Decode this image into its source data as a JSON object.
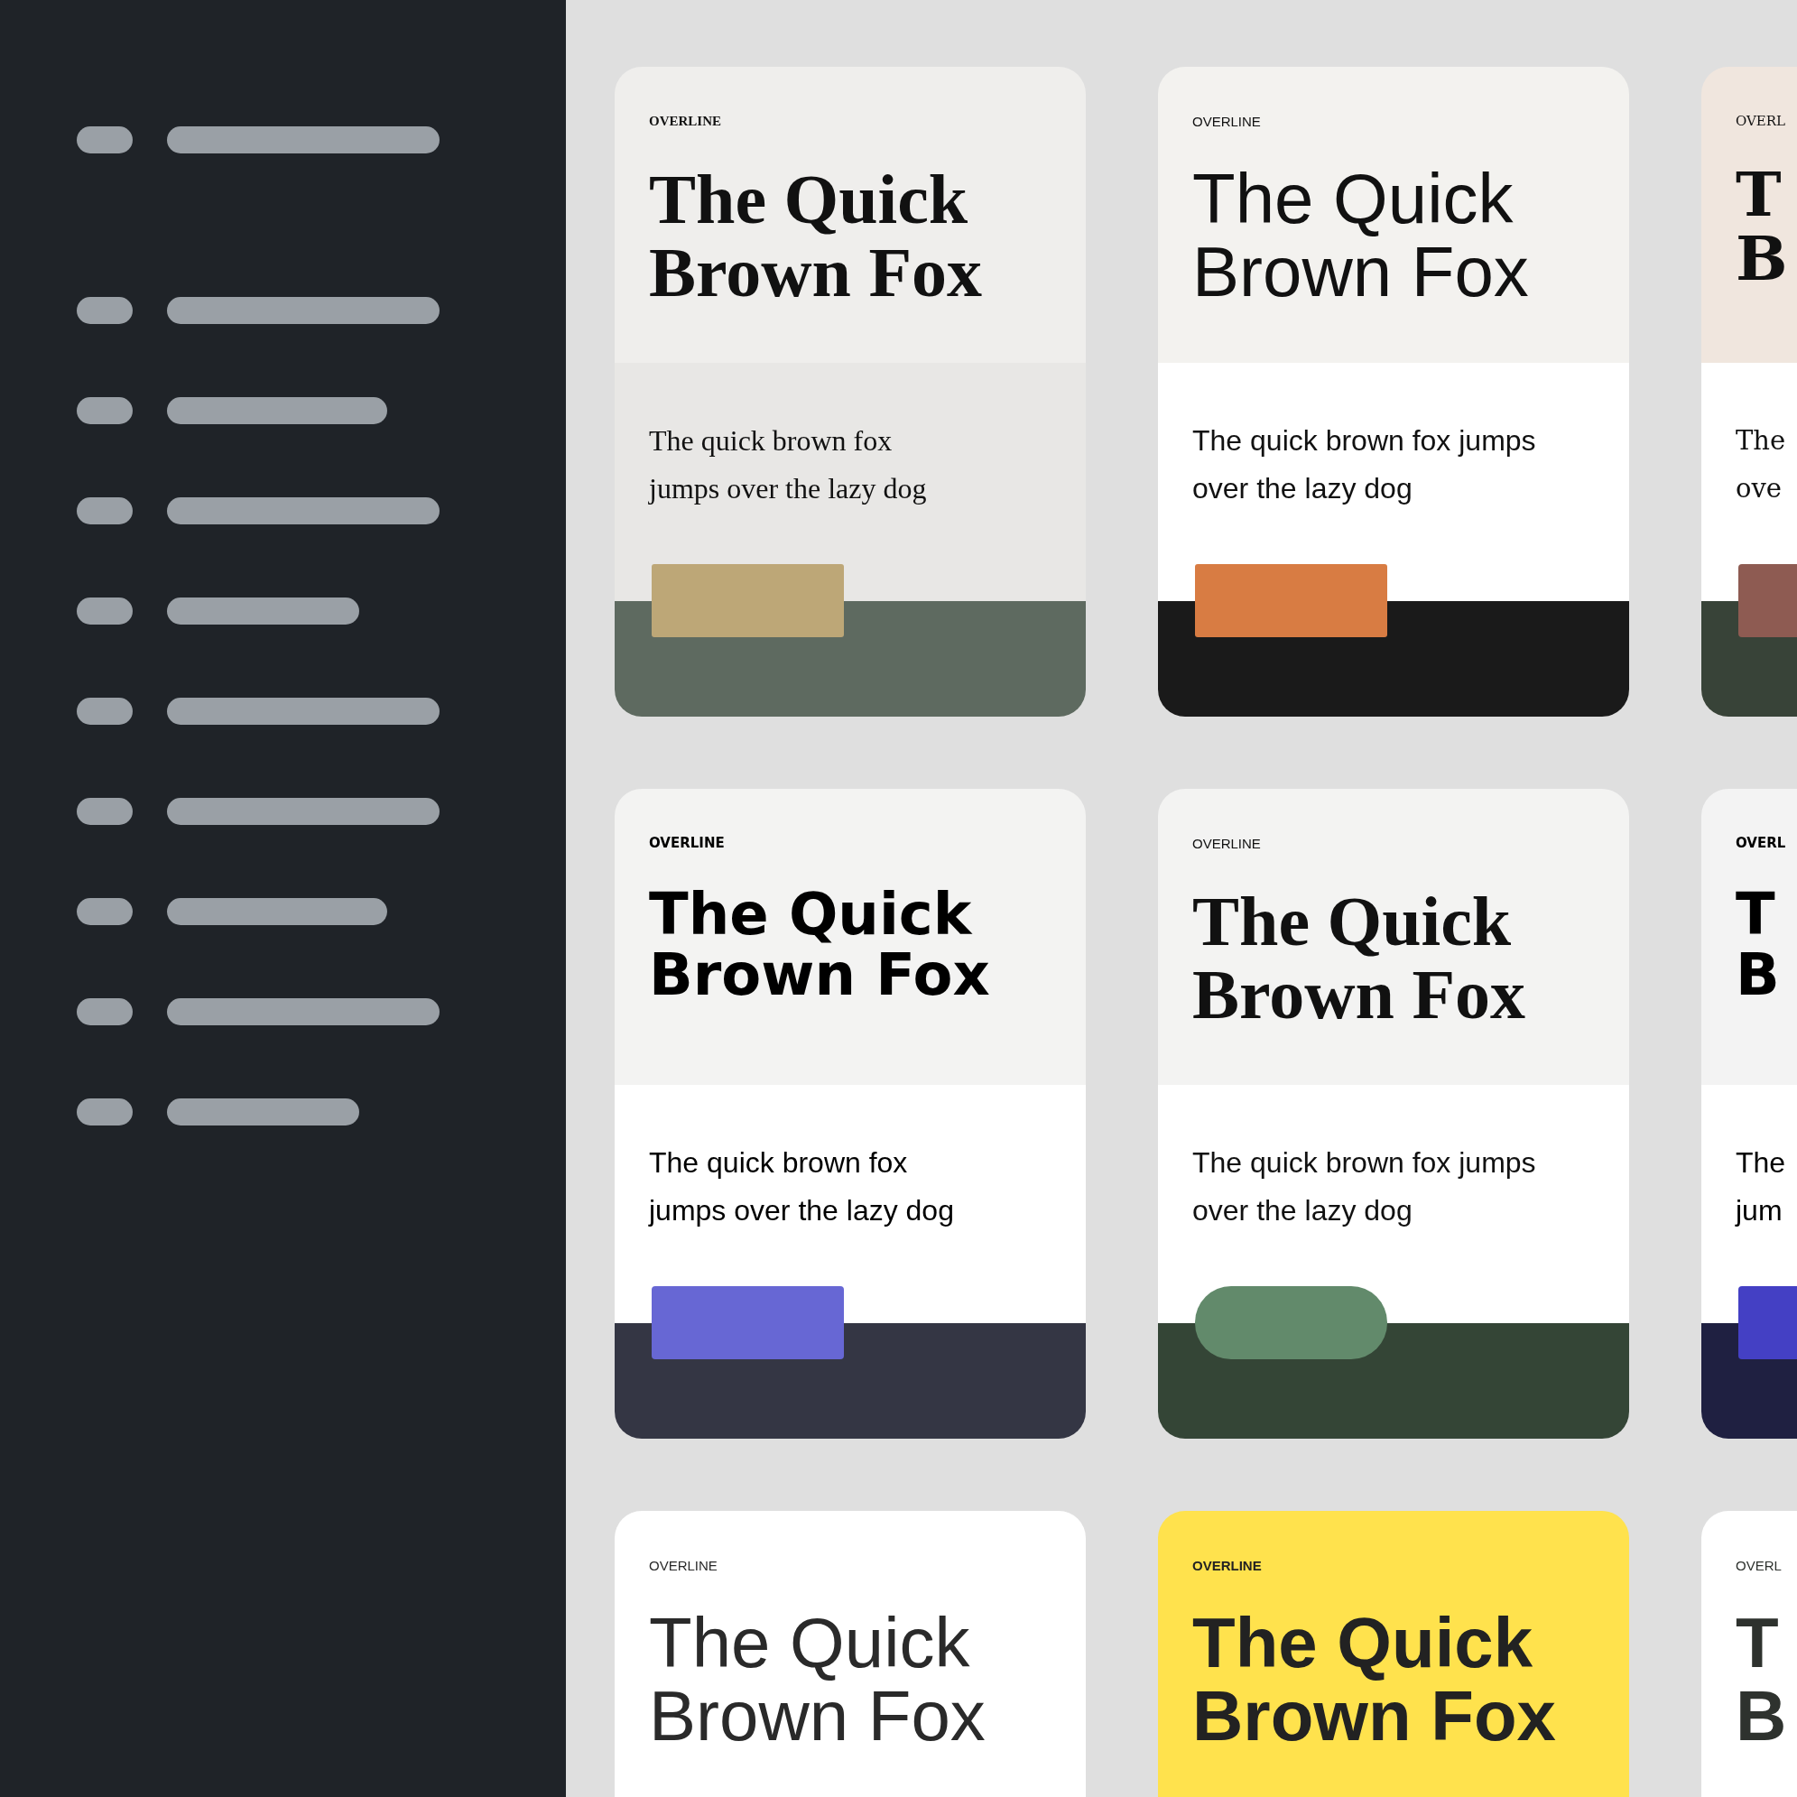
{
  "cards": [
    {
      "kind": "editorial",
      "overline": "OVERLINE",
      "title": "The Quick\nBrown Fox",
      "body": "The quick brown fox\njumps over the lazy dog"
    },
    {
      "kind": "geometric",
      "overline": "OVERLINE",
      "title": "The Quick\nBrown Fox",
      "body": "The quick brown fox jumps\nover the lazy dog"
    },
    {
      "kind": "classic",
      "overline": "OVERL",
      "title": "T\nB",
      "body": "The\nove"
    },
    {
      "kind": "grotesk",
      "overline": "OVERLINE",
      "title": "The Quick\nBrown Fox",
      "body": "The quick brown fox\njumps over the lazy dog"
    },
    {
      "kind": "display",
      "overline": "OVERLINE",
      "title": "The Quick\nBrown Fox",
      "body": "The quick brown fox jumps\nover the lazy dog"
    },
    {
      "kind": "bold",
      "overline": "OVERL",
      "title": "T\nB",
      "body": "The\njum"
    },
    {
      "kind": "clean",
      "overline": "OVERLINE",
      "title": "The Quick\nBrown Fox"
    },
    {
      "kind": "sunny",
      "overline": "OVERLINE",
      "title": "The Quick\nBrown Fox"
    },
    {
      "kind": "plain",
      "overline": "OVERL",
      "title": "T\nB"
    }
  ]
}
